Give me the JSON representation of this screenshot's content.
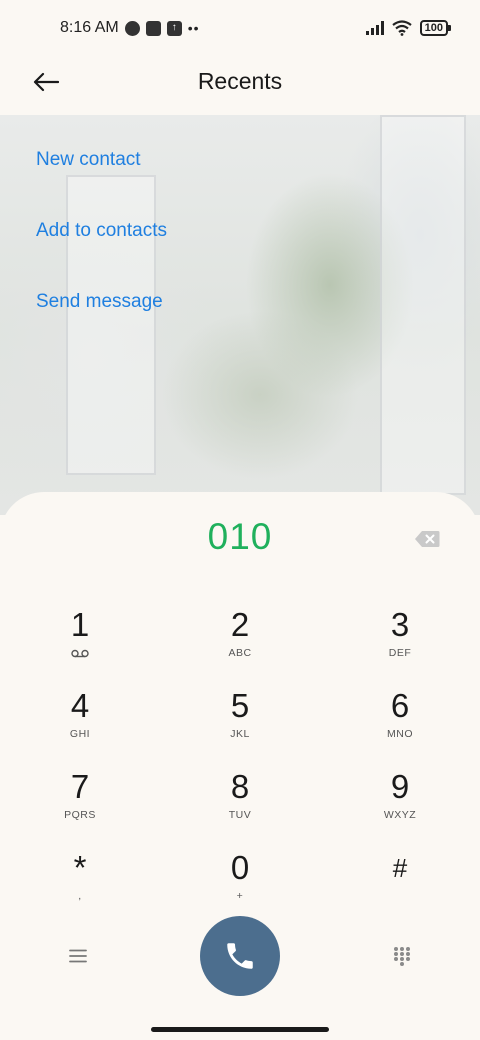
{
  "status_bar": {
    "time": "8:16 AM",
    "battery": "100"
  },
  "app_bar": {
    "title": "Recents"
  },
  "actions": [
    {
      "label": "New contact"
    },
    {
      "label": "Add to contacts"
    },
    {
      "label": "Send message"
    }
  ],
  "dialer": {
    "number": "010",
    "keys": [
      {
        "digit": "1",
        "letters": ""
      },
      {
        "digit": "2",
        "letters": "ABC"
      },
      {
        "digit": "3",
        "letters": "DEF"
      },
      {
        "digit": "4",
        "letters": "GHI"
      },
      {
        "digit": "5",
        "letters": "JKL"
      },
      {
        "digit": "6",
        "letters": "MNO"
      },
      {
        "digit": "7",
        "letters": "PQRS"
      },
      {
        "digit": "8",
        "letters": "TUV"
      },
      {
        "digit": "9",
        "letters": "WXYZ"
      },
      {
        "digit": "*",
        "letters": ","
      },
      {
        "digit": "0",
        "letters": "+"
      },
      {
        "digit": "#",
        "letters": ""
      }
    ]
  },
  "colors": {
    "accent_link": "#1f7fe0",
    "number_text": "#1fb05c",
    "call_button": "#4c6e8e",
    "background": "#fbf8f3"
  },
  "icons": {
    "back": "arrow-left-icon",
    "backspace": "backspace-icon",
    "voicemail": "voicemail-icon",
    "menu": "menu-icon",
    "call": "phone-icon",
    "dialpad": "dialpad-icon",
    "wifi": "wifi-icon",
    "signal": "signal-icon"
  }
}
